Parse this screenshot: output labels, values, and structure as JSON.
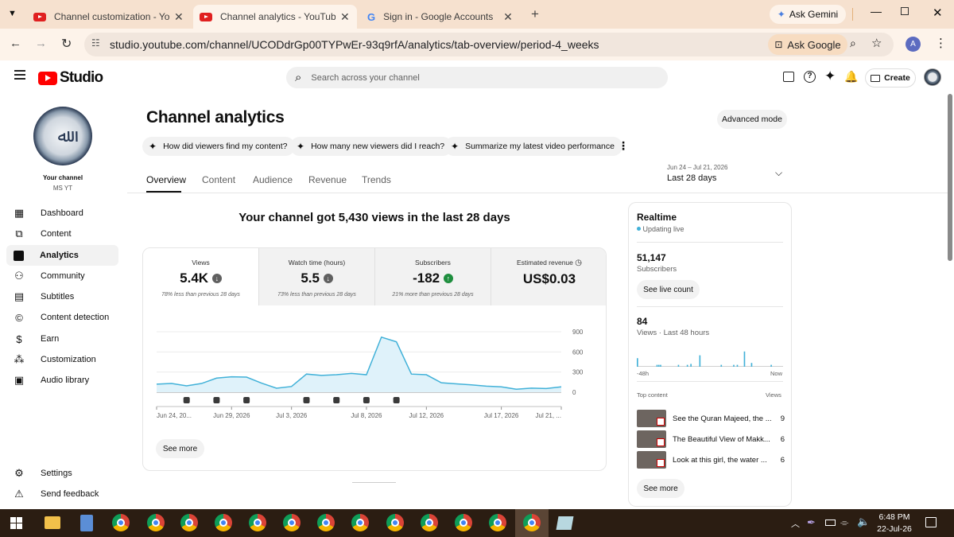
{
  "browser": {
    "tabs": [
      {
        "title": "Channel customization - YouTube",
        "active": false
      },
      {
        "title": "Channel analytics - YouTube Studio",
        "active": true
      },
      {
        "title": "Sign in - Google Accounts",
        "active": false
      }
    ],
    "ask_gemini": "Ask Gemini",
    "url": "studio.youtube.com/channel/UCODdrGp00TYPwEr-93q9rfA/analytics/tab-overview/period-4_weeks",
    "ask_google": "Ask Google",
    "profile_initial": "A"
  },
  "studio": {
    "logo_text": "Studio",
    "search_placeholder": "Search across your channel",
    "create_label": "Create",
    "channel_label": "Your channel",
    "channel_name": "MS YT",
    "nav": [
      {
        "label": "Dashboard",
        "icon": "dashboard-icon"
      },
      {
        "label": "Content",
        "icon": "content-icon"
      },
      {
        "label": "Analytics",
        "icon": "analytics-icon"
      },
      {
        "label": "Community",
        "icon": "community-icon"
      },
      {
        "label": "Subtitles",
        "icon": "subtitles-icon"
      },
      {
        "label": "Content detection",
        "icon": "copyright-icon"
      },
      {
        "label": "Earn",
        "icon": "dollar-icon"
      },
      {
        "label": "Customization",
        "icon": "magic-wand-icon"
      },
      {
        "label": "Audio library",
        "icon": "audio-library-icon"
      }
    ],
    "nav_bottom": [
      {
        "label": "Settings",
        "icon": "gear-icon"
      },
      {
        "label": "Send feedback",
        "icon": "feedback-icon"
      }
    ]
  },
  "analytics": {
    "title": "Channel analytics",
    "advanced_mode": "Advanced mode",
    "chips": [
      "How did viewers find my content?",
      "How many new viewers did I reach?",
      "Summarize my latest video performance"
    ],
    "tabs": [
      "Overview",
      "Content",
      "Audience",
      "Revenue",
      "Trends"
    ],
    "date_range": "Jun 24 – Jul 21, 2026",
    "period_label": "Last 28 days",
    "headline": "Your channel got 5,430 views in the last 28 days",
    "metrics": [
      {
        "label": "Views",
        "value": "5.4K",
        "trend": "down",
        "sub": "78% less than previous 28 days"
      },
      {
        "label": "Watch time (hours)",
        "value": "5.5",
        "trend": "down",
        "sub": "73% less than previous 28 days"
      },
      {
        "label": "Subscribers",
        "value": "-182",
        "trend": "up",
        "sub": "21% more than previous 28 days"
      },
      {
        "label": "Estimated revenue",
        "value": "US$0.03",
        "trend": "none",
        "sub": ""
      }
    ],
    "see_more": "See more"
  },
  "realtime": {
    "title": "Realtime",
    "status": "Updating live",
    "subscribers_value": "51,147",
    "subscribers_label": "Subscribers",
    "see_live": "See live count",
    "views_value": "84",
    "views_label": "Views · Last 48 hours",
    "axis_start": "-48h",
    "axis_end": "Now",
    "top_content_label": "Top content",
    "views_col": "Views",
    "top_content": [
      {
        "title": "See the Quran Majeed, the ...",
        "views": "9"
      },
      {
        "title": "The Beautiful View of Makk...",
        "views": "6"
      },
      {
        "title": "Look at this girl, the water ...",
        "views": "6"
      }
    ],
    "see_more": "See more",
    "bars": [
      0.45,
      0,
      0,
      0,
      0,
      0,
      0,
      0,
      0,
      0,
      0,
      0.1,
      0.1,
      0.1,
      0,
      0,
      0,
      0,
      0,
      0,
      0,
      0,
      0,
      0.1,
      0,
      0,
      0,
      0,
      0.1,
      0,
      0.15,
      0,
      0,
      0,
      0,
      0.6,
      0,
      0,
      0,
      0,
      0,
      0,
      0,
      0,
      0,
      0,
      0,
      0.1,
      0,
      0,
      0,
      0,
      0,
      0,
      0.1,
      0,
      0.1,
      0,
      0,
      0,
      0.8,
      0,
      0,
      0,
      0.2,
      0,
      0,
      0,
      0,
      0,
      0,
      0,
      0,
      0,
      0,
      0.1,
      0,
      0,
      0,
      0,
      0,
      0
    ]
  },
  "chart_data": {
    "type": "line",
    "x": [
      "Jun 24",
      "Jun 25",
      "Jun 26",
      "Jun 27",
      "Jun 28",
      "Jun 29",
      "Jun 30",
      "Jul 1",
      "Jul 2",
      "Jul 3",
      "Jul 4",
      "Jul 5",
      "Jul 6",
      "Jul 7",
      "Jul 8",
      "Jul 9",
      "Jul 10",
      "Jul 11",
      "Jul 12",
      "Jul 13",
      "Jul 14",
      "Jul 15",
      "Jul 16",
      "Jul 17",
      "Jul 18",
      "Jul 19",
      "Jul 20",
      "Jul 21"
    ],
    "series": [
      {
        "values": [
          120,
          130,
          95,
          130,
          210,
          230,
          225,
          135,
          60,
          85,
          270,
          250,
          260,
          280,
          260,
          820,
          750,
          270,
          260,
          140,
          125,
          110,
          90,
          80,
          45,
          60,
          55,
          80
        ]
      }
    ],
    "x_tick_labels": [
      "Jun 24, 20...",
      "Jun 29, 2026",
      "Jul 3, 2026",
      "Jul 8, 2026",
      "Jul 12, 2026",
      "Jul 17, 2026",
      "Jul 21, ..."
    ],
    "y_ticks": [
      "900",
      "600",
      "300",
      "0"
    ],
    "ylim": [
      0,
      900
    ],
    "markers": [
      "Jun 26",
      "Jun 28",
      "Jun 30",
      "Jul 4",
      "Jul 6",
      "Jul 8",
      "Jul 10"
    ],
    "color": "#41b1d8",
    "fill": "#dff2fa"
  },
  "taskbar": {
    "time": "6:48 PM",
    "date": "22-Jul-26"
  }
}
